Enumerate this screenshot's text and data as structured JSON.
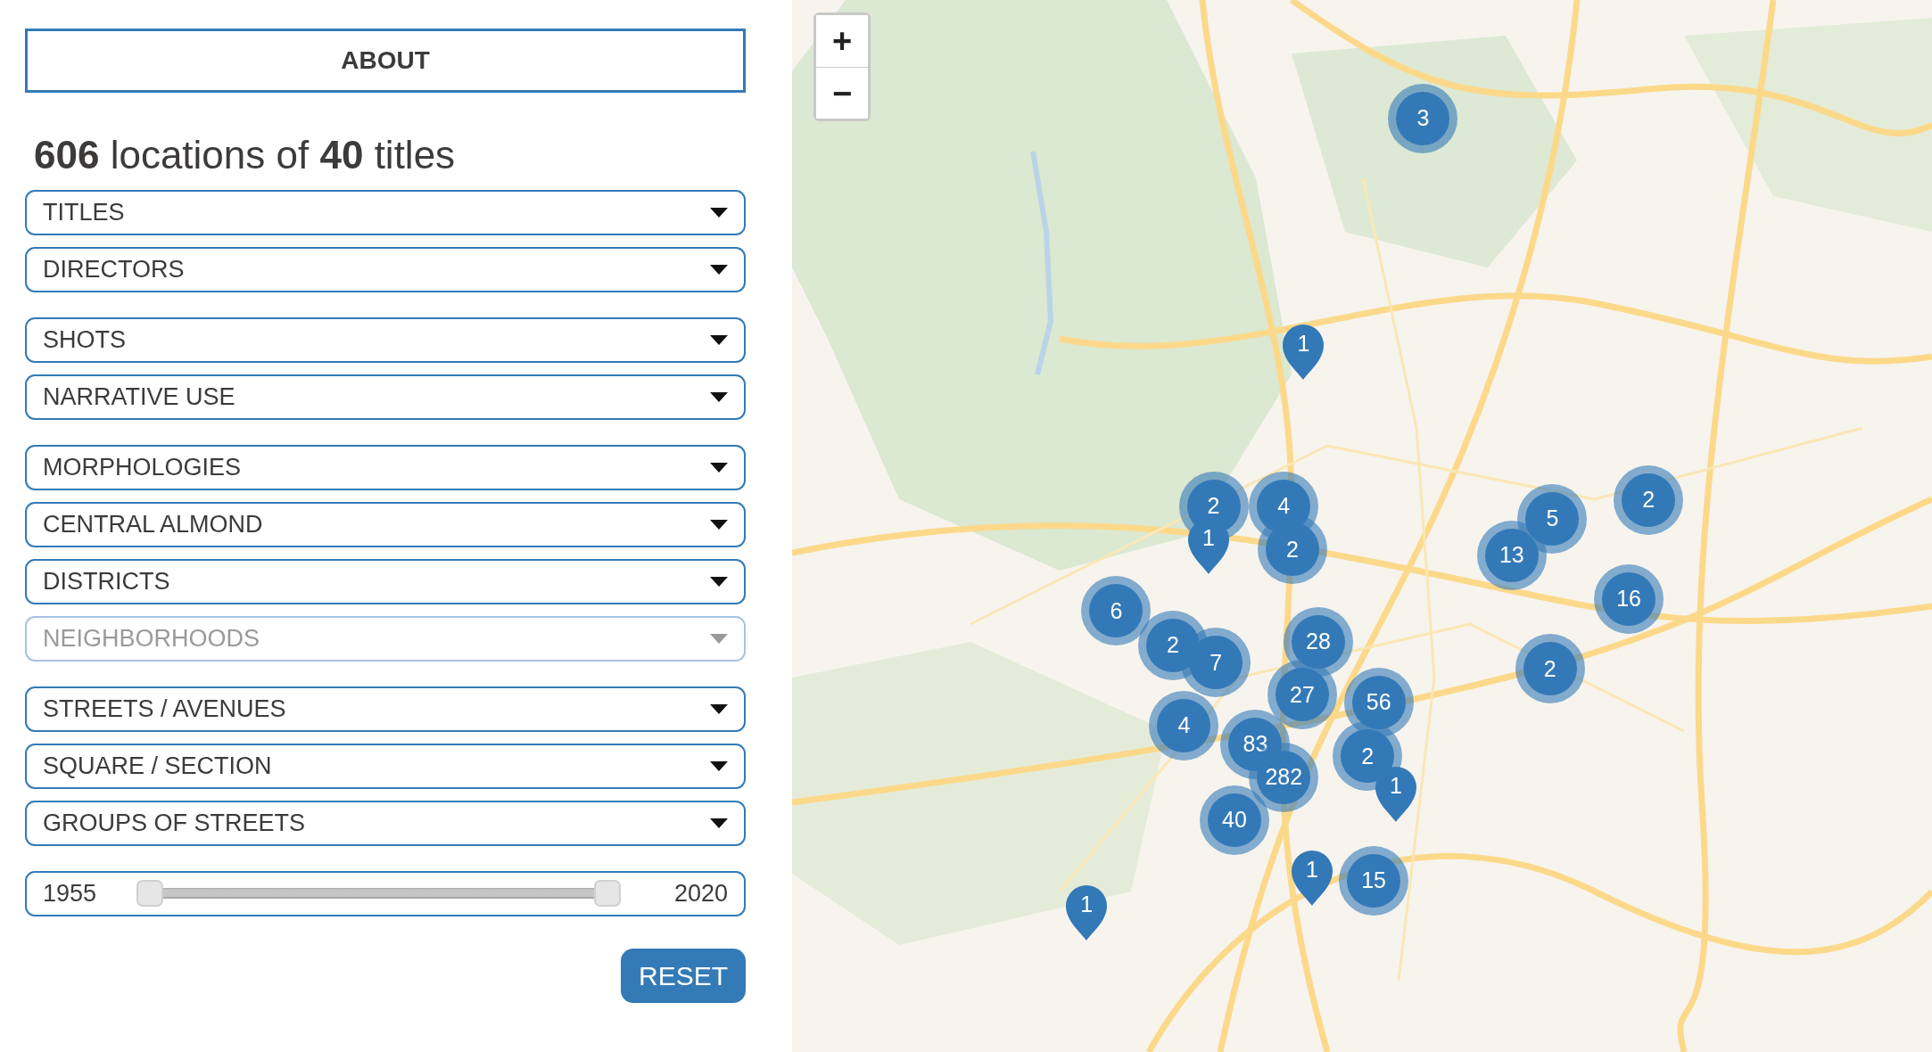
{
  "about_button": "ABOUT",
  "summary": "**606** locations of **40** titles",
  "filter_groups": [
    {
      "filters": [
        {
          "label": "TITLES",
          "disabled": false
        },
        {
          "label": "DIRECTORS",
          "disabled": false
        }
      ]
    },
    {
      "filters": [
        {
          "label": "SHOTS",
          "disabled": false
        },
        {
          "label": "NARRATIVE USE",
          "disabled": false
        }
      ]
    },
    {
      "filters": [
        {
          "label": "MORPHOLOGIES",
          "disabled": false
        },
        {
          "label": "CENTRAL ALMOND",
          "disabled": false
        },
        {
          "label": "DISTRICTS",
          "disabled": false
        },
        {
          "label": "NEIGHBORHOODS",
          "disabled": true
        }
      ]
    },
    {
      "filters": [
        {
          "label": "STREETS / AVENUES",
          "disabled": false
        },
        {
          "label": "SQUARE / SECTION",
          "disabled": false
        },
        {
          "label": "GROUPS OF STREETS",
          "disabled": false
        }
      ]
    }
  ],
  "year_slider": {
    "min_label": "1955",
    "max_label": "2020",
    "thumbs": [
      {
        "level": 0
      },
      {
        "level": 1
      }
    ]
  },
  "reset_button": "RESET",
  "map": {
    "zoom_buttons": [
      "+",
      "−"
    ],
    "markers": [
      {
        "label": "3",
        "kind": "cluster"
      },
      {
        "label": "1",
        "kind": "pin"
      },
      {
        "label": "2",
        "kind": "cluster"
      },
      {
        "label": "4",
        "kind": "cluster"
      },
      {
        "label": "2",
        "kind": "cluster"
      },
      {
        "label": "5",
        "kind": "cluster"
      },
      {
        "label": "1",
        "kind": "pin"
      },
      {
        "label": "2",
        "kind": "cluster"
      },
      {
        "label": "13",
        "kind": "cluster"
      },
      {
        "label": "6",
        "kind": "cluster"
      },
      {
        "label": "16",
        "kind": "cluster"
      },
      {
        "label": "28",
        "kind": "cluster"
      },
      {
        "label": "2",
        "kind": "cluster"
      },
      {
        "label": "7",
        "kind": "cluster"
      },
      {
        "label": "2",
        "kind": "cluster"
      },
      {
        "label": "27",
        "kind": "cluster"
      },
      {
        "label": "56",
        "kind": "cluster"
      },
      {
        "label": "4",
        "kind": "cluster"
      },
      {
        "label": "83",
        "kind": "cluster"
      },
      {
        "label": "2",
        "kind": "cluster"
      },
      {
        "label": "282",
        "kind": "cluster"
      },
      {
        "label": "1",
        "kind": "pin"
      },
      {
        "label": "40",
        "kind": "cluster"
      },
      {
        "label": "1",
        "kind": "pin"
      },
      {
        "label": "15",
        "kind": "cluster"
      },
      {
        "label": "1",
        "kind": "pin"
      }
    ]
  }
}
